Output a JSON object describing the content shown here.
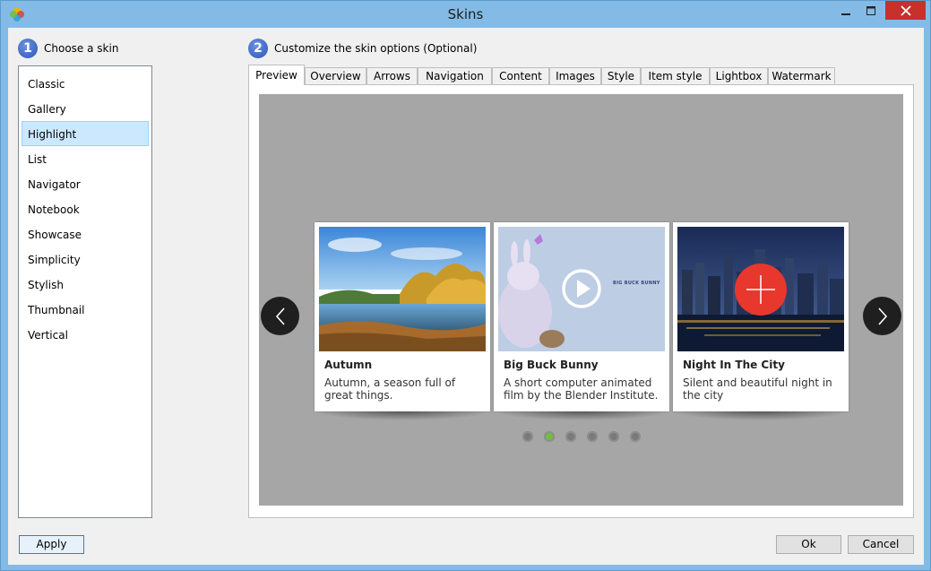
{
  "window": {
    "title": "Skins"
  },
  "steps": {
    "step1": {
      "number": "1",
      "label": "Choose a skin"
    },
    "step2": {
      "number": "2",
      "label": "Customize the skin options (Optional)"
    }
  },
  "skins": [
    "Classic",
    "Gallery",
    "Highlight",
    "List",
    "Navigator",
    "Notebook",
    "Showcase",
    "Simplicity",
    "Stylish",
    "Thumbnail",
    "Vertical"
  ],
  "selected_skin": "Highlight",
  "tabs": [
    "Preview",
    "Overview",
    "Arrows",
    "Navigation",
    "Content",
    "Images",
    "Style",
    "Item style",
    "Lightbox",
    "Watermark"
  ],
  "active_tab": "Preview",
  "slides": [
    {
      "title": "Autumn",
      "desc": "Autumn, a season full of great things."
    },
    {
      "title": "Big Buck Bunny",
      "desc": "A short computer animated film by the Blender Institute.",
      "poster_text": "BIG BUCK BUNNY"
    },
    {
      "title": "Night In The City",
      "desc": "Silent and beautiful night in the city"
    }
  ],
  "pagination": {
    "count": 6,
    "active_index": 1
  },
  "buttons": {
    "apply": "Apply",
    "ok": "Ok",
    "cancel": "Cancel"
  },
  "colors": {
    "accent": "#2b54b8",
    "close": "#c7312b",
    "dot_active": "#6fbf3b",
    "plus_circle": "#e8372c"
  }
}
